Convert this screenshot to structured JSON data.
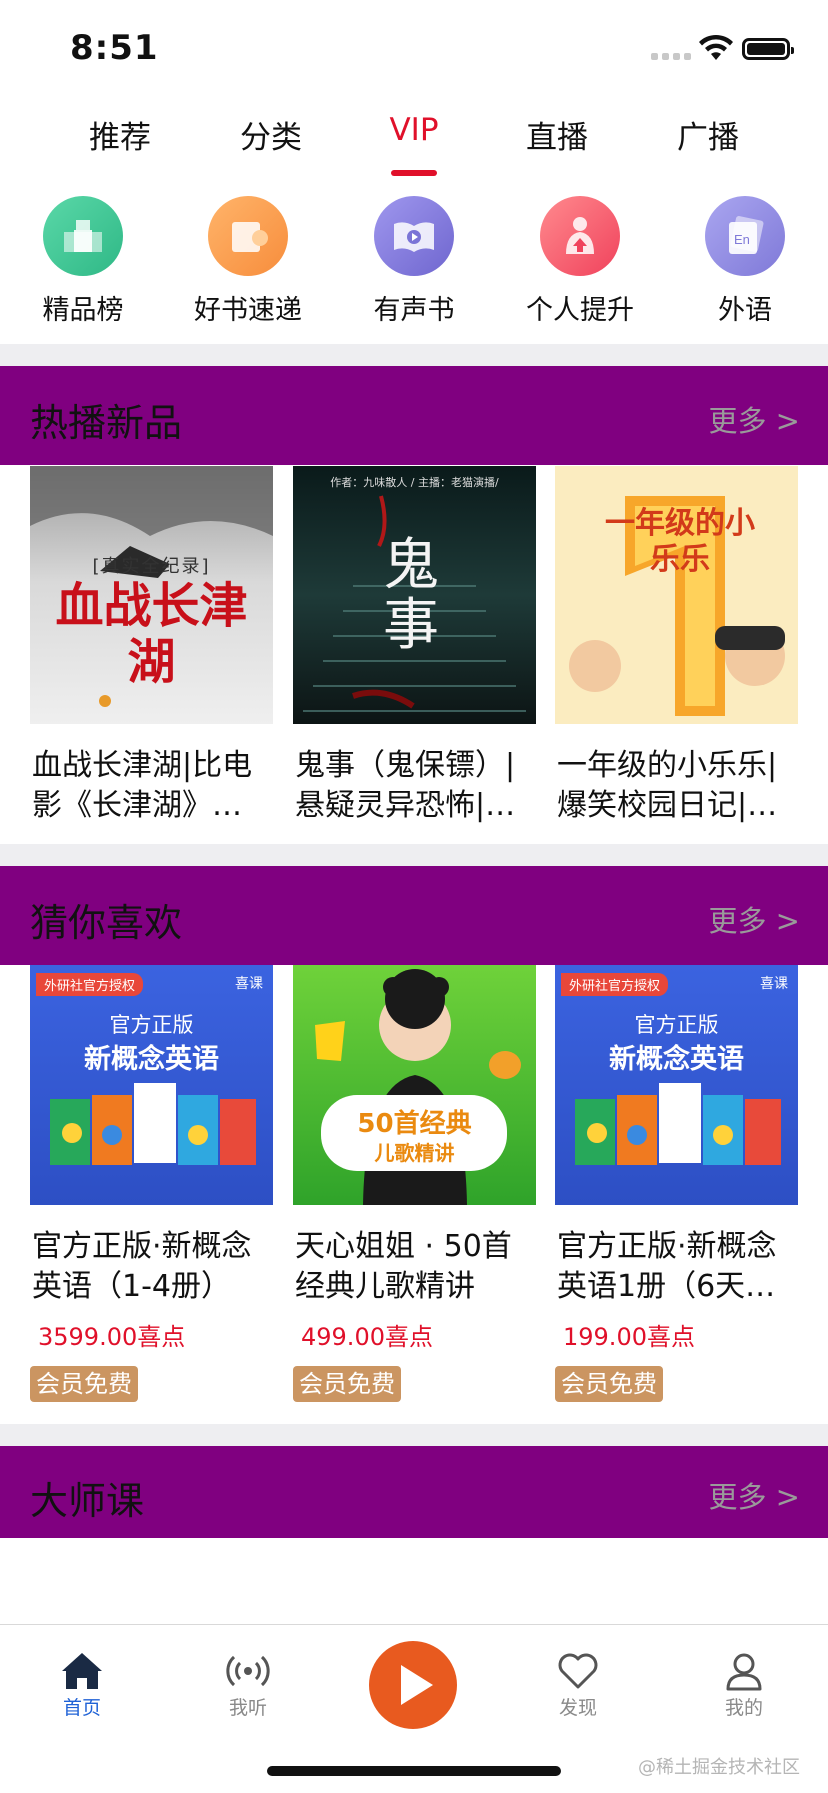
{
  "status_bar": {
    "time": "8:51"
  },
  "top_tabs": [
    {
      "label": "推荐",
      "active": false
    },
    {
      "label": "分类",
      "active": false
    },
    {
      "label": "VIP",
      "active": true
    },
    {
      "label": "直播",
      "active": false
    },
    {
      "label": "广播",
      "active": false
    }
  ],
  "categories": [
    {
      "label": "精品榜",
      "icon": "ranking-icon",
      "color": "#36c392"
    },
    {
      "label": "好书速递",
      "icon": "book-delivery-icon",
      "color": "#f99a4c"
    },
    {
      "label": "有声书",
      "icon": "audiobook-icon",
      "color": "#7b74d6"
    },
    {
      "label": "个人提升",
      "icon": "self-improvement-icon",
      "color": "#f4516a"
    },
    {
      "label": "外语",
      "icon": "foreign-language-icon",
      "color": "#8b86e0"
    }
  ],
  "sections": {
    "hot_new": {
      "title": "热播新品",
      "more": "更多 >",
      "books": [
        {
          "title": "血战长津湖|比电影《长津湖》…",
          "cover_text": "血战长津湖",
          "cover_sub": "[真实全纪录]"
        },
        {
          "title": "鬼事（鬼保镖）|悬疑灵异恐怖|…",
          "cover_text": "鬼事",
          "cover_sub": "作者：九味散人 / 主播：老猫演播/"
        },
        {
          "title": "一年级的小乐乐|爆笑校园日记|…",
          "cover_text": "一年级的小乐乐"
        }
      ]
    },
    "guess_like": {
      "title": "猜你喜欢",
      "more": "更多 >",
      "books": [
        {
          "title": "官方正版·新概念英语（1-4册）",
          "price": "3599.00喜点",
          "badge": "会员免费",
          "cover_tag": "外研社官方授权",
          "cover_brand": "喜课",
          "cover_line1": "官方正版",
          "cover_line2": "新概念英语"
        },
        {
          "title": "天心姐姐 · 50首经典儿歌精讲",
          "price": "499.00喜点",
          "badge": "会员免费",
          "cover_line1": "50首经典",
          "cover_line2": "儿歌精讲"
        },
        {
          "title": "官方正版·新概念英语1册（6天…",
          "price": "199.00喜点",
          "badge": "会员免费",
          "cover_tag": "外研社官方授权",
          "cover_brand": "喜课",
          "cover_line1": "官方正版",
          "cover_line2": "新概念英语"
        }
      ]
    },
    "master": {
      "title": "大师课",
      "more": "更多 >"
    }
  },
  "bottom_tabs": [
    {
      "label": "首页",
      "icon": "home-icon",
      "active": true
    },
    {
      "label": "我听",
      "icon": "broadcast-icon",
      "active": false
    },
    {
      "label": "",
      "icon": "play-icon",
      "active": false
    },
    {
      "label": "发现",
      "icon": "heart-icon",
      "active": false
    },
    {
      "label": "我的",
      "icon": "user-icon",
      "active": false
    }
  ],
  "watermark": "@稀土掘金技术社区",
  "colors": {
    "accent": "#e0102a",
    "section_header_bg": "#800080",
    "badge_bg": "#cb9561",
    "play_button": "#e85a1f",
    "active_tab_blue": "#1f62d6"
  }
}
